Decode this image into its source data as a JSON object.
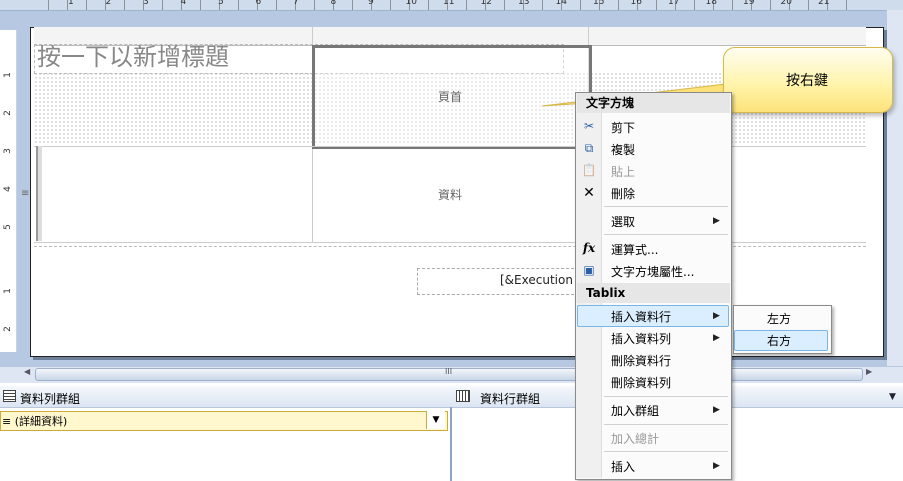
{
  "ruler": {
    "top_labels": [
      "1",
      "2",
      "3",
      "4",
      "5",
      "6",
      "7",
      "8",
      "9",
      "10",
      "11",
      "12",
      "13",
      "14",
      "15",
      "16",
      "17",
      "18",
      "19",
      "20",
      "21"
    ],
    "left_labels": [
      "1",
      "2",
      "3",
      "4",
      "5",
      "1",
      "2"
    ]
  },
  "report": {
    "title_placeholder": "按一下以新增標題",
    "header_text": "頁首",
    "detail_text": "資料",
    "execution_field": "[&Execution"
  },
  "callout": {
    "text": "按右鍵"
  },
  "context_menu": {
    "header1": "文字方塊",
    "items_top": [
      {
        "label": "剪下",
        "icon": "scissors-icon",
        "glyph": "✂",
        "disabled": false
      },
      {
        "label": "複製",
        "icon": "copy-icon",
        "glyph": "⧉",
        "disabled": false
      },
      {
        "label": "貼上",
        "icon": "paste-icon",
        "glyph": "📋",
        "disabled": true
      },
      {
        "label": "刪除",
        "icon": "delete-icon",
        "glyph": "✕",
        "disabled": false
      }
    ],
    "select_label": "選取",
    "expression_label": "運算式...",
    "expression_glyph": "fx",
    "properties_label": "文字方塊屬性...",
    "header2": "Tablix",
    "tablix_items": [
      {
        "label": "插入資料行",
        "has_submenu": true
      },
      {
        "label": "插入資料列",
        "has_submenu": true
      },
      {
        "label": "刪除資料行",
        "has_submenu": false
      },
      {
        "label": "刪除資料列",
        "has_submenu": false
      }
    ],
    "add_group_label": "加入群組",
    "add_total_label": "加入總計",
    "insert_label": "插入",
    "submenu_arrow": "▶"
  },
  "submenu": {
    "items": [
      "左方",
      "右方"
    ],
    "highlighted_index": 1
  },
  "panels": {
    "row_groups_title": "資料列群組",
    "column_groups_title": "資料行群組",
    "row_group_item": "≡ (詳細資料)",
    "dropdown_glyph": "▼"
  },
  "scrollbar": {
    "left": "◀",
    "right": "▶",
    "grip": "III"
  },
  "handle_glyph": "≡"
}
